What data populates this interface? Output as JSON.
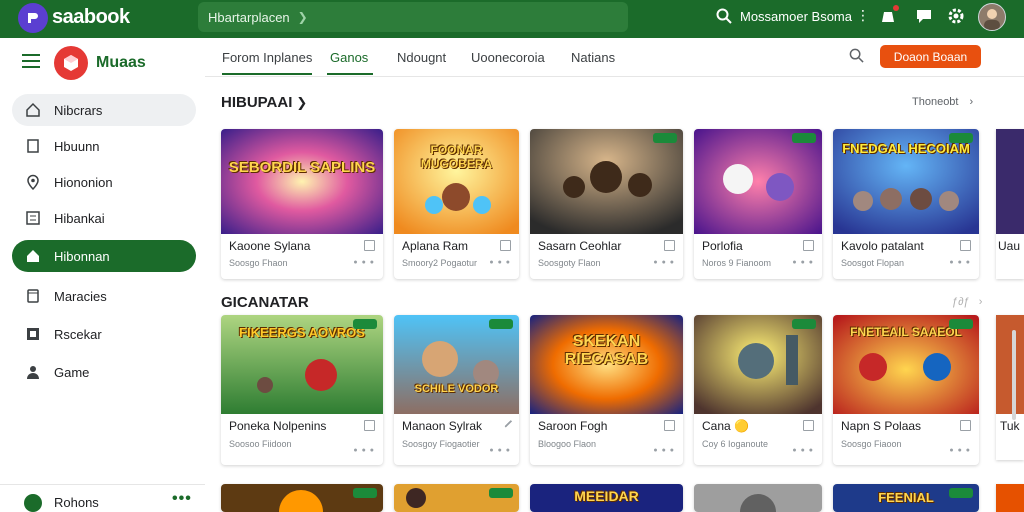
{
  "topbar": {
    "brand": "saabook",
    "search_text": "Hbartarplacen",
    "right_label": "Mossamoer Bsoma",
    "colors": {
      "bar": "#1b6b2a",
      "accent": "#e8500f"
    }
  },
  "sidebar": {
    "brand": "Muaas",
    "items": [
      {
        "label": "Nibcrars",
        "icon": "home-outline-icon",
        "state": "hover"
      },
      {
        "label": "Hbuunn",
        "icon": "file-icon",
        "state": ""
      },
      {
        "label": "Hiononion",
        "icon": "location-icon",
        "state": ""
      },
      {
        "label": "Hibankai",
        "icon": "grid-doc-icon",
        "state": ""
      },
      {
        "label": "Hibonnan",
        "icon": "home-filled-icon",
        "state": "active"
      },
      {
        "label": "Maracies",
        "icon": "tablet-icon",
        "state": ""
      },
      {
        "label": "Rscekar",
        "icon": "d-box-icon",
        "state": ""
      },
      {
        "label": "Game",
        "icon": "person-icon",
        "state": ""
      }
    ],
    "footer_label": "Rohons",
    "footer_more": "•••"
  },
  "tabs": {
    "items": [
      "Forom Inplanes",
      "Ganos",
      "Ndougnt",
      "Uoonecoroia",
      "Natians"
    ],
    "active": 1,
    "cta_label": "Doaon Boaan"
  },
  "sections": [
    {
      "title": "HIBUPAAI",
      "see_all": "Thoneobt",
      "cards": [
        {
          "title": "Kaoone Sylana",
          "sub": "Soosgo Fhaon",
          "caption": "SEBORDIL SAPLINS"
        },
        {
          "title": "Aplana Ram",
          "sub": "Smoory2 Pogaotur",
          "caption": "FOONAR MUGOBERA"
        },
        {
          "title": "Sasarn Ceohlar",
          "sub": "Soosgoty Flaon",
          "caption": ""
        },
        {
          "title": "Porlofia",
          "sub": "Noros 9 Fianoom",
          "caption": ""
        },
        {
          "title": "Kavolo patalant",
          "sub": "Soosgot Flopan",
          "caption": "FNEDGAL HECOIAM"
        }
      ],
      "peek_title": "Uau"
    },
    {
      "title": "GICANATAR",
      "see_all": "ƒ∂ƒ",
      "cards": [
        {
          "title": "Poneka Nolpenins",
          "sub": "Soosoo Fiidoon",
          "caption": "FIKEERGS AOVROS"
        },
        {
          "title": "Manaon Sylrak",
          "sub": "Soosgoy Fiogaotier",
          "caption": "SCHILE VODOR"
        },
        {
          "title": "Saroon Fogh",
          "sub": "Bloogoo Flaon",
          "caption": "SKEKAN RIECASAB"
        },
        {
          "title": "Cana 🟡",
          "sub": "Coy 6 Ioganoute",
          "caption": ""
        },
        {
          "title": "Napn S Polaas",
          "sub": "Soosgo Fiaoon",
          "caption": "FNETEAIL SAAEOL"
        }
      ],
      "peek_title": "Tuk"
    },
    {
      "title": "",
      "see_all": "",
      "cards": [
        {
          "title": "",
          "sub": "",
          "caption": ""
        },
        {
          "title": "",
          "sub": "",
          "caption": ""
        },
        {
          "title": "",
          "sub": "",
          "caption": "MEEIDAR"
        },
        {
          "title": "",
          "sub": "",
          "caption": ""
        },
        {
          "title": "",
          "sub": "",
          "caption": "FEENIAL"
        }
      ]
    }
  ]
}
